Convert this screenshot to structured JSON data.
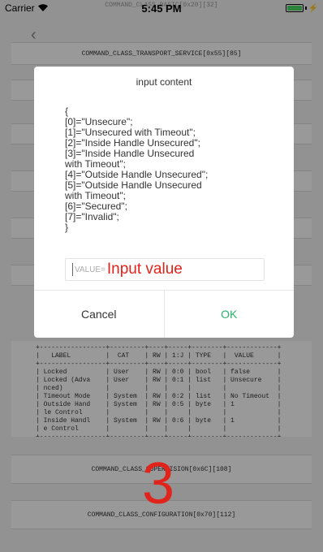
{
  "status": {
    "carrier": "Carrier",
    "time": "5:45 PM"
  },
  "background": {
    "header_text": "COMMAND_CLASS_BASIC[0x20][32]",
    "transport_service": "COMMAND_CLASS_TRANSPORT_SERVICE[0x55][85]",
    "table_text": "+-----------------+---------+----+-----+--------+-------------+\n|   LABEL         |  CAT    | RW | 1:J | TYPE   |  VALUE      |\n+-----------------+---------+----+-----+--------+-------------+\n| Locked          | User    | RW | 0:0 | bool   | false       |\n| Locked (Adva    | User    | RW | 0:1 | list   | Unsecure    |\n| nced)           |         |    |     |        |             |\n| Timeout Mode    | System  | RW | 0:2 | list   | No Timeout  |\n| Outside Hand    | System  | RW | 0:5 | byte   | 1           |\n| le Control      |         |    |     |        |             |\n| Inside Handl    | System  | RW | 0:6 | byte   | 1           |\n| e Control       |         |    |     |        |             |\n+-----------------+---------+----+-----+--------+-------------+",
    "supervision": "COMMAND_CLASS_SUPERVISION[0x6C][108]",
    "configuration": "COMMAND_CLASS_CONFIGURATION[0x70][112]",
    "annotation_number": "3"
  },
  "dialog": {
    "title": "input content",
    "body": "{\n[0]=\"Unsecure\";\n[1]=\"Unsecured with Timeout\";\n[2]=\"Inside Handle Unsecured\";\n[3]=\"Inside Handle Unsecured\nwith Timeout\";\n[4]=\"Outside Handle Unsecured\";\n[5]=\"Outside Handle Unsecured\nwith Timeout\";\n[6]=\"Secured\";\n[7]=\"Invalid\";\n}",
    "input_placeholder": "VALUE=",
    "input_hint": "Input value",
    "cancel_label": "Cancel",
    "ok_label": "OK"
  },
  "colors": {
    "accent_ok": "#29b36a",
    "annotation_red": "#e0241b",
    "battery_green": "#4cd964"
  }
}
